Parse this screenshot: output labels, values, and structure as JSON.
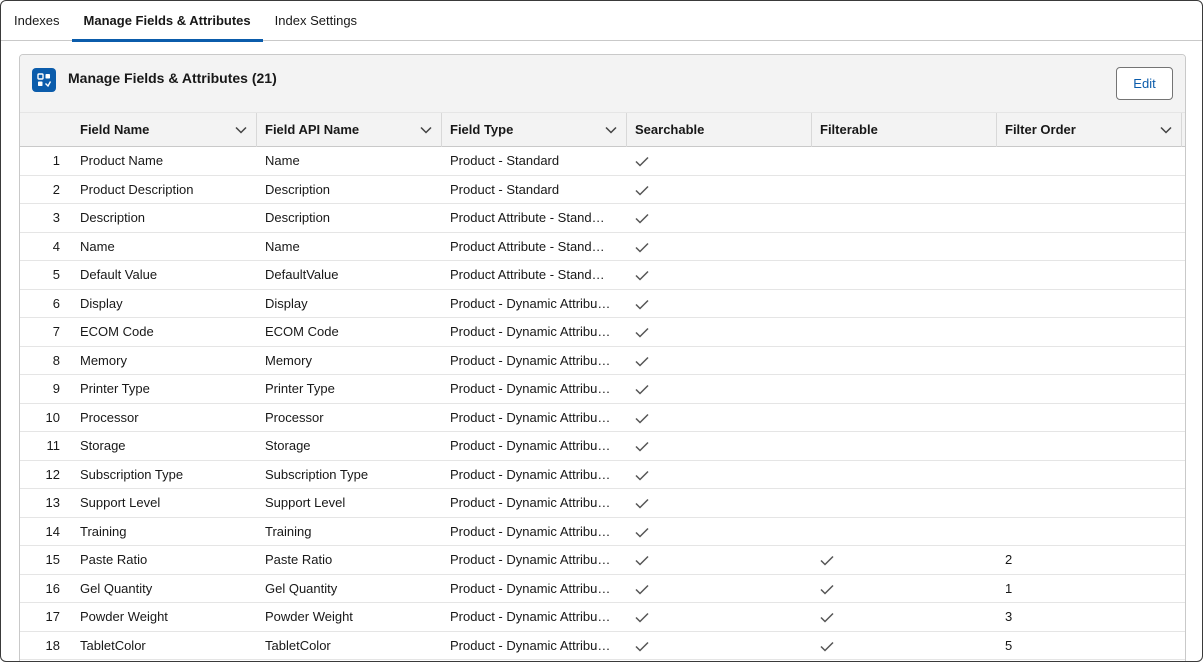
{
  "tabs": [
    {
      "label": "Indexes"
    },
    {
      "label": "Manage Fields & Attributes"
    },
    {
      "label": "Index Settings"
    }
  ],
  "card": {
    "title": "Manage Fields & Attributes (21)",
    "edit_label": "Edit",
    "icon": "index-fields-icon"
  },
  "columns": [
    {
      "label": "Field Name",
      "sortable": true
    },
    {
      "label": "Field API Name",
      "sortable": true
    },
    {
      "label": "Field Type",
      "sortable": true
    },
    {
      "label": "Searchable",
      "sortable": false
    },
    {
      "label": "Filterable",
      "sortable": false
    },
    {
      "label": "Filter Order",
      "sortable": true
    }
  ],
  "rows": [
    {
      "n": "1",
      "name": "Product Name",
      "api": "Name",
      "type": "Product - Standard",
      "searchable": true,
      "filterable": false,
      "order": ""
    },
    {
      "n": "2",
      "name": "Product Description",
      "api": "Description",
      "type": "Product - Standard",
      "searchable": true,
      "filterable": false,
      "order": ""
    },
    {
      "n": "3",
      "name": "Description",
      "api": "Description",
      "type": "Product Attribute - Stand…",
      "searchable": true,
      "filterable": false,
      "order": ""
    },
    {
      "n": "4",
      "name": "Name",
      "api": "Name",
      "type": "Product Attribute - Stand…",
      "searchable": true,
      "filterable": false,
      "order": ""
    },
    {
      "n": "5",
      "name": "Default Value",
      "api": "DefaultValue",
      "type": "Product Attribute - Stand…",
      "searchable": true,
      "filterable": false,
      "order": ""
    },
    {
      "n": "6",
      "name": "Display",
      "api": "Display",
      "type": "Product - Dynamic Attribu…",
      "searchable": true,
      "filterable": false,
      "order": ""
    },
    {
      "n": "7",
      "name": "ECOM Code",
      "api": "ECOM Code",
      "type": "Product - Dynamic Attribu…",
      "searchable": true,
      "filterable": false,
      "order": ""
    },
    {
      "n": "8",
      "name": "Memory",
      "api": "Memory",
      "type": "Product - Dynamic Attribu…",
      "searchable": true,
      "filterable": false,
      "order": ""
    },
    {
      "n": "9",
      "name": "Printer Type",
      "api": "Printer Type",
      "type": "Product - Dynamic Attribu…",
      "searchable": true,
      "filterable": false,
      "order": ""
    },
    {
      "n": "10",
      "name": "Processor",
      "api": "Processor",
      "type": "Product - Dynamic Attribu…",
      "searchable": true,
      "filterable": false,
      "order": ""
    },
    {
      "n": "11",
      "name": "Storage",
      "api": "Storage",
      "type": "Product - Dynamic Attribu…",
      "searchable": true,
      "filterable": false,
      "order": ""
    },
    {
      "n": "12",
      "name": "Subscription Type",
      "api": "Subscription Type",
      "type": "Product - Dynamic Attribu…",
      "searchable": true,
      "filterable": false,
      "order": ""
    },
    {
      "n": "13",
      "name": "Support Level",
      "api": "Support Level",
      "type": "Product - Dynamic Attribu…",
      "searchable": true,
      "filterable": false,
      "order": ""
    },
    {
      "n": "14",
      "name": "Training",
      "api": "Training",
      "type": "Product - Dynamic Attribu…",
      "searchable": true,
      "filterable": false,
      "order": ""
    },
    {
      "n": "15",
      "name": "Paste Ratio",
      "api": "Paste Ratio",
      "type": "Product - Dynamic Attribu…",
      "searchable": true,
      "filterable": true,
      "order": "2"
    },
    {
      "n": "16",
      "name": "Gel Quantity",
      "api": "Gel Quantity",
      "type": "Product - Dynamic Attribu…",
      "searchable": true,
      "filterable": true,
      "order": "1"
    },
    {
      "n": "17",
      "name": "Powder Weight",
      "api": "Powder Weight",
      "type": "Product - Dynamic Attribu…",
      "searchable": true,
      "filterable": true,
      "order": "3"
    },
    {
      "n": "18",
      "name": "TabletColor",
      "api": "TabletColor",
      "type": "Product - Dynamic Attribu…",
      "searchable": true,
      "filterable": true,
      "order": "5"
    }
  ],
  "colors": {
    "accent": "#0b5cab",
    "header_bg": "#f3f3f3",
    "border": "#c9c9c9"
  }
}
